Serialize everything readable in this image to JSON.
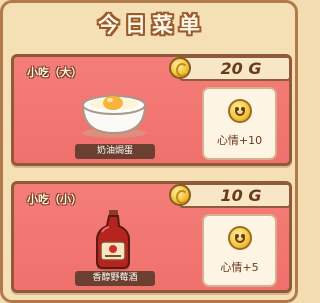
{
  "title": "今日菜单",
  "currency_symbol": "G",
  "items": [
    {
      "name": "小吃（大）",
      "price": "20 G",
      "dish": "奶油焗蛋",
      "dish_icon": "baked-egg-icon",
      "effect": "心情+10",
      "effect_icon": "smiley-icon"
    },
    {
      "name": "小吃（小）",
      "price": "10 G",
      "dish": "香醇野莓酒",
      "dish_icon": "berry-wine-bottle-icon",
      "effect": "心情+5",
      "effect_icon": "smiley-icon"
    }
  ],
  "colors": {
    "card_bg": "#f0706d",
    "border": "#8f5a3a",
    "panel_bg": "#f5dfb4",
    "gold": "#f2c43a"
  }
}
